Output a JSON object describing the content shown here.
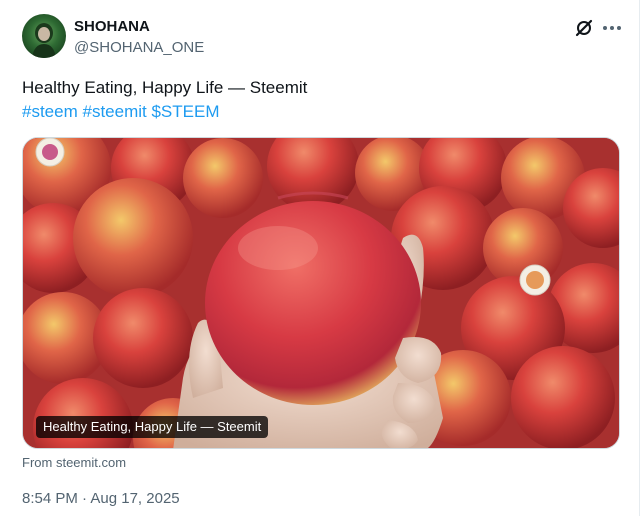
{
  "author": {
    "display_name": "SHOHANA",
    "handle": "@SHOHANA_ONE"
  },
  "tweet": {
    "text_line1": "Healthy Eating, Happy Life — Steemit",
    "hashtags": [
      "#steem",
      "#steemit"
    ],
    "cashtag": "$STEEM"
  },
  "card": {
    "caption": "Healthy Eating, Happy Life — Steemit",
    "image_subject": "hand-holding-red-apple"
  },
  "source": {
    "from_prefix": "From",
    "domain": "steemit.com"
  },
  "meta": {
    "time": "8:54 PM",
    "separator": "·",
    "date": "Aug 17, 2025"
  },
  "colors": {
    "link": "#1d9bf0",
    "secondary_text": "#536471",
    "primary_text": "#0f1419",
    "border": "#cfd9de"
  },
  "icons": [
    "grok-icon",
    "more-icon"
  ]
}
